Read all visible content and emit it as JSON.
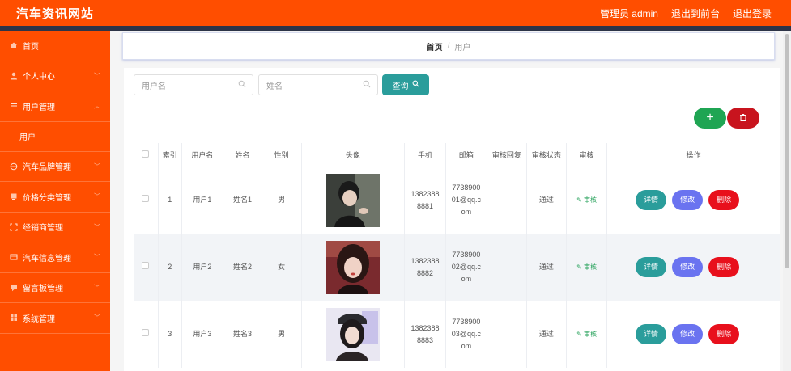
{
  "header": {
    "site_title": "汽车资讯网站",
    "admin_label": "管理员 admin",
    "to_front": "退出到前台",
    "logout": "退出登录"
  },
  "sidebar": {
    "items": [
      {
        "label": "首页",
        "icon": "home-icon"
      },
      {
        "label": "个人中心",
        "icon": "user-icon"
      },
      {
        "label": "用户管理",
        "icon": "list-icon"
      },
      {
        "label": "用户",
        "icon": ""
      },
      {
        "label": "汽车品牌管理",
        "icon": "globe-icon"
      },
      {
        "label": "价格分类管理",
        "icon": "tag-icon"
      },
      {
        "label": "经销商管理",
        "icon": "frame-icon"
      },
      {
        "label": "汽车信息管理",
        "icon": "card-icon"
      },
      {
        "label": "留言板管理",
        "icon": "message-icon"
      },
      {
        "label": "系统管理",
        "icon": "grid-icon"
      }
    ]
  },
  "breadcrumb": {
    "home": "首页",
    "separator": "/",
    "current": "用户"
  },
  "search": {
    "username_placeholder": "用户名",
    "name_placeholder": "姓名",
    "query_label": "查询"
  },
  "toolbar": {
    "add_icon": "+",
    "delete_icon": "trash-icon"
  },
  "table": {
    "columns": [
      "索引",
      "用户名",
      "姓名",
      "性别",
      "头像",
      "手机",
      "邮箱",
      "审核回复",
      "审核状态",
      "审核",
      "操作"
    ],
    "rows": [
      {
        "index": "1",
        "username": "用户1",
        "name": "姓名1",
        "gender": "男",
        "phone_a": "1382388",
        "phone_b": "8881",
        "email_a": "7738900",
        "email_b": "01@qq.c",
        "email_c": "om",
        "reply": "",
        "status": "通过",
        "audit": "审核"
      },
      {
        "index": "2",
        "username": "用户2",
        "name": "姓名2",
        "gender": "女",
        "phone_a": "1382388",
        "phone_b": "8882",
        "email_a": "7738900",
        "email_b": "02@qq.c",
        "email_c": "om",
        "reply": "",
        "status": "通过",
        "audit": "审核"
      },
      {
        "index": "3",
        "username": "用户3",
        "name": "姓名3",
        "gender": "男",
        "phone_a": "1382388",
        "phone_b": "8883",
        "email_a": "7738900",
        "email_b": "03@qq.c",
        "email_c": "om",
        "reply": "",
        "status": "通过",
        "audit": "审核"
      }
    ],
    "actions": {
      "detail": "详情",
      "edit": "修改",
      "delete": "删除"
    }
  },
  "colors": {
    "brand": "#ff4e00",
    "teal": "#2a9d9b",
    "green": "#1fa553",
    "red": "#c8141e",
    "purple": "#6a73f0"
  }
}
